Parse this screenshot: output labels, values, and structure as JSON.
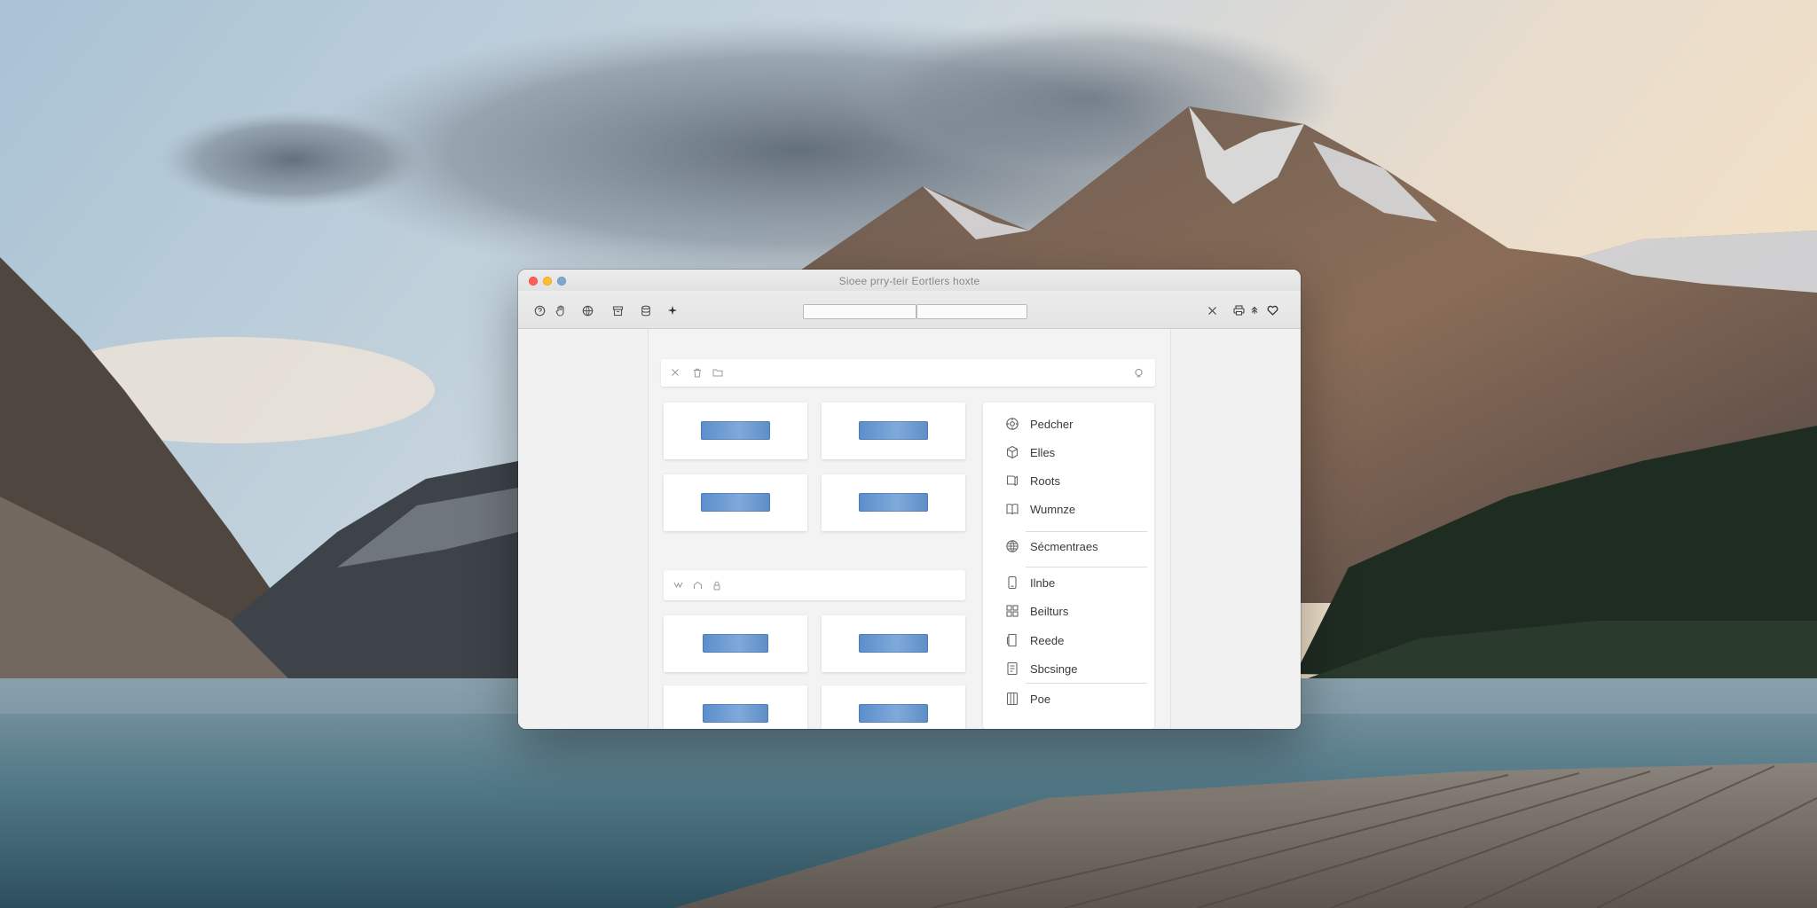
{
  "window": {
    "title": "Sioee prry-teir Eortlers hoxte"
  },
  "menu": {
    "items": [
      {
        "label": "Pedcher",
        "icon": "gear-icon"
      },
      {
        "label": "Elles",
        "icon": "cube-icon"
      },
      {
        "label": "Roots",
        "icon": "book-icon"
      },
      {
        "label": "Wumnze",
        "icon": "book-open-icon"
      },
      {
        "label": "Sécmentraes",
        "icon": "globe-icon"
      },
      {
        "label": "Ilnbe",
        "icon": "phone-icon"
      },
      {
        "label": "Beilturs",
        "icon": "grid-icon"
      },
      {
        "label": "Reede",
        "icon": "tablet-icon"
      },
      {
        "label": "Sbcsinge",
        "icon": "document-icon"
      },
      {
        "label": "Poe",
        "icon": "columns-icon"
      }
    ]
  },
  "colors": {
    "accent": "#6b9bd3",
    "close": "#fe5f57",
    "minimize": "#febc2e",
    "zoom": "#7fa6cf"
  }
}
